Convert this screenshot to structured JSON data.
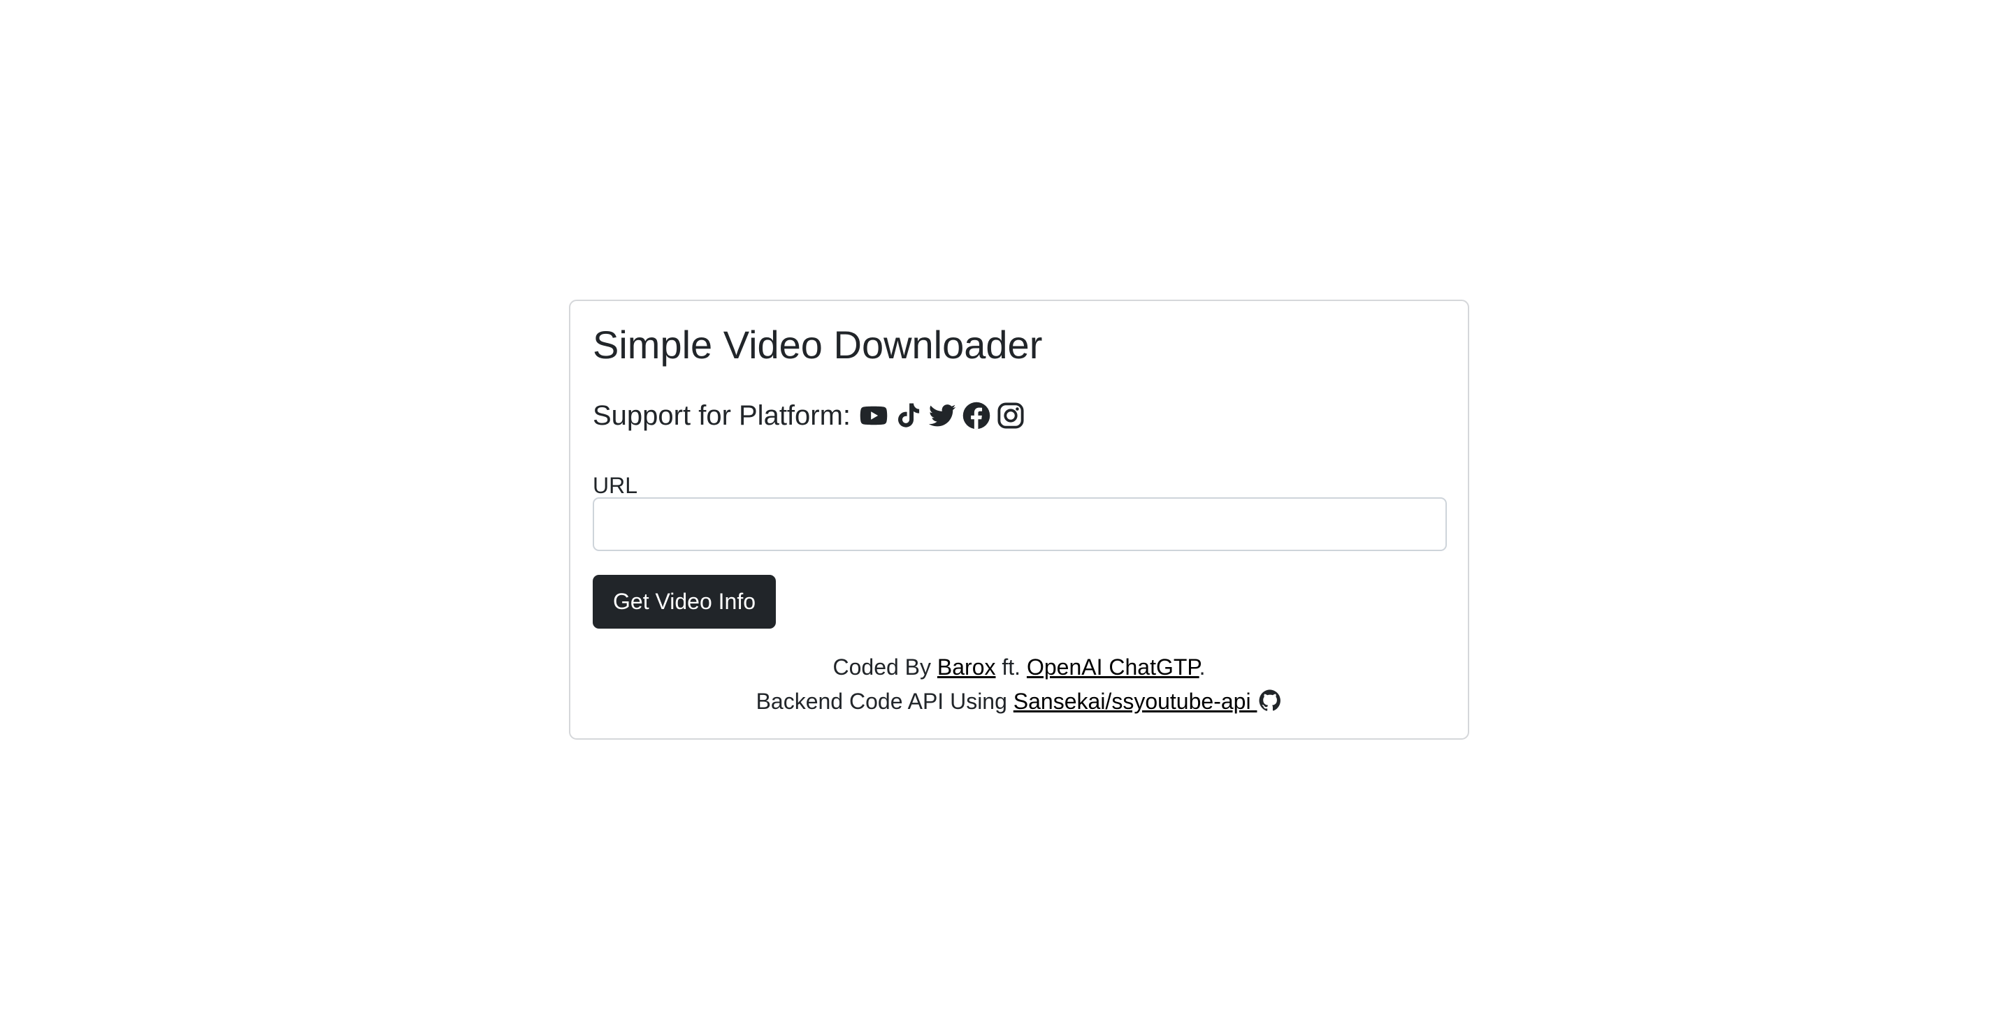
{
  "card": {
    "title": "Simple Video Downloader",
    "platform_label": "Support for Platform:",
    "platform_icons": [
      "youtube-icon",
      "tiktok-icon",
      "twitter-icon",
      "facebook-icon",
      "instagram-icon"
    ]
  },
  "form": {
    "url_label": "URL",
    "url_value": "",
    "submit_label": "Get Video Info"
  },
  "footer": {
    "line1_prefix": "Coded By",
    "author_link": "Barox",
    "line1_middle": "ft.",
    "ai_link": "OpenAI ChatGTP",
    "line1_suffix": ".",
    "line2_prefix": "Backend Code API Using",
    "repo_link": "Sansekai/ssyoutube-api",
    "repo_icon": "github-icon"
  },
  "colors": {
    "text": "#212529",
    "button_bg": "#212529",
    "button_text": "#ffffff",
    "border": "#d5d7da",
    "link": "#000000"
  }
}
